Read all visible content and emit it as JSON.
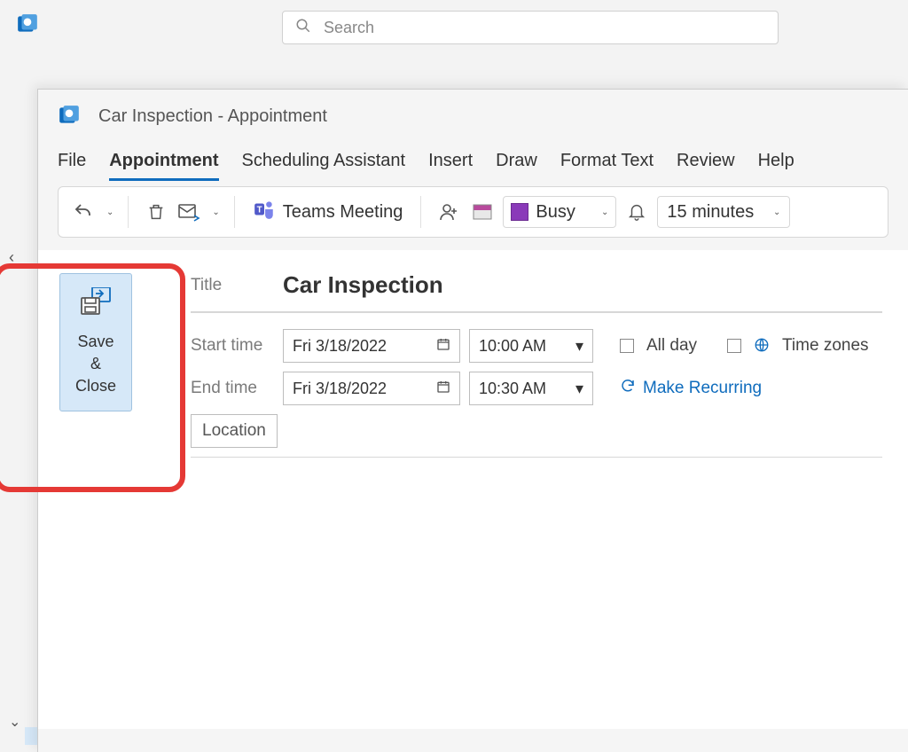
{
  "bg_search_placeholder": "Search",
  "window": {
    "title": "Car Inspection  -  Appointment",
    "tabs": [
      "File",
      "Appointment",
      "Scheduling Assistant",
      "Insert",
      "Draw",
      "Format Text",
      "Review",
      "Help"
    ],
    "active_tab": "Appointment"
  },
  "ribbon": {
    "teams_meeting": "Teams Meeting",
    "busy_label": "Busy",
    "reminder_value": "15 minutes"
  },
  "save_close_label": "Save\n&\nClose",
  "fields": {
    "title_label": "Title",
    "title_value": "Car Inspection",
    "start_label": "Start time",
    "start_date": "Fri 3/18/2022",
    "start_time": "10:00 AM",
    "end_label": "End time",
    "end_date": "Fri 3/18/2022",
    "end_time": "10:30 AM",
    "all_day": "All day",
    "time_zones": "Time zones",
    "make_recurring": "Make Recurring",
    "location_label": "Location"
  }
}
